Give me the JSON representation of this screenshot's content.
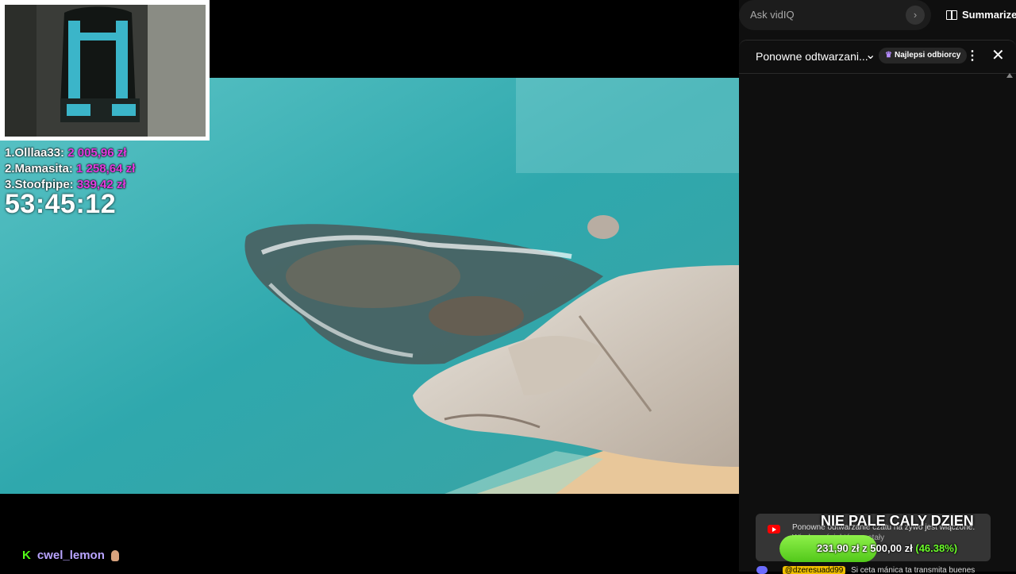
{
  "overlay": {
    "leaderboard": [
      {
        "rank_name": "1.Olllaa33:",
        "amount": "2 005,96 zł"
      },
      {
        "rank_name": "2.Mamasita:",
        "amount": "1 258,64 zł"
      },
      {
        "rank_name": "3.Stoofpipe:",
        "amount": "339,42 zł"
      }
    ],
    "timer": "53:45:12",
    "user": {
      "platform_glyph": "K",
      "name": "cwel_lemon"
    }
  },
  "vidiq": {
    "ask_placeholder": "Ask vidIQ",
    "send_glyph": "›",
    "summarize_label": "Summarize"
  },
  "chat_header": {
    "title": "Ponowne odtwarzani...",
    "chevron": "⌄",
    "filter_badge": "Najlepsi odbiorcy",
    "more_glyph": "⋮",
    "close_glyph": "✕"
  },
  "replay_notice": {
    "line1": "Ponowne odtwarzanie czatu na żywo jest włączone.",
    "line2": "Wiadomości, które zostały"
  },
  "goal": {
    "title": "NIE PALE CALY DZIEN",
    "current": "231,90 zł",
    "separator": "z",
    "target": "500,00 zł",
    "percent_label": "(46.38%)",
    "progress": 0.4638
  },
  "chat_preview": {
    "author": "@dzeresuadd99",
    "message": "Si ceta mánica ta transmita buenes"
  },
  "colors": {
    "donation_amount": "#e23be0",
    "goal_fill": "#6cff2a",
    "kick_green": "#53fc18"
  }
}
